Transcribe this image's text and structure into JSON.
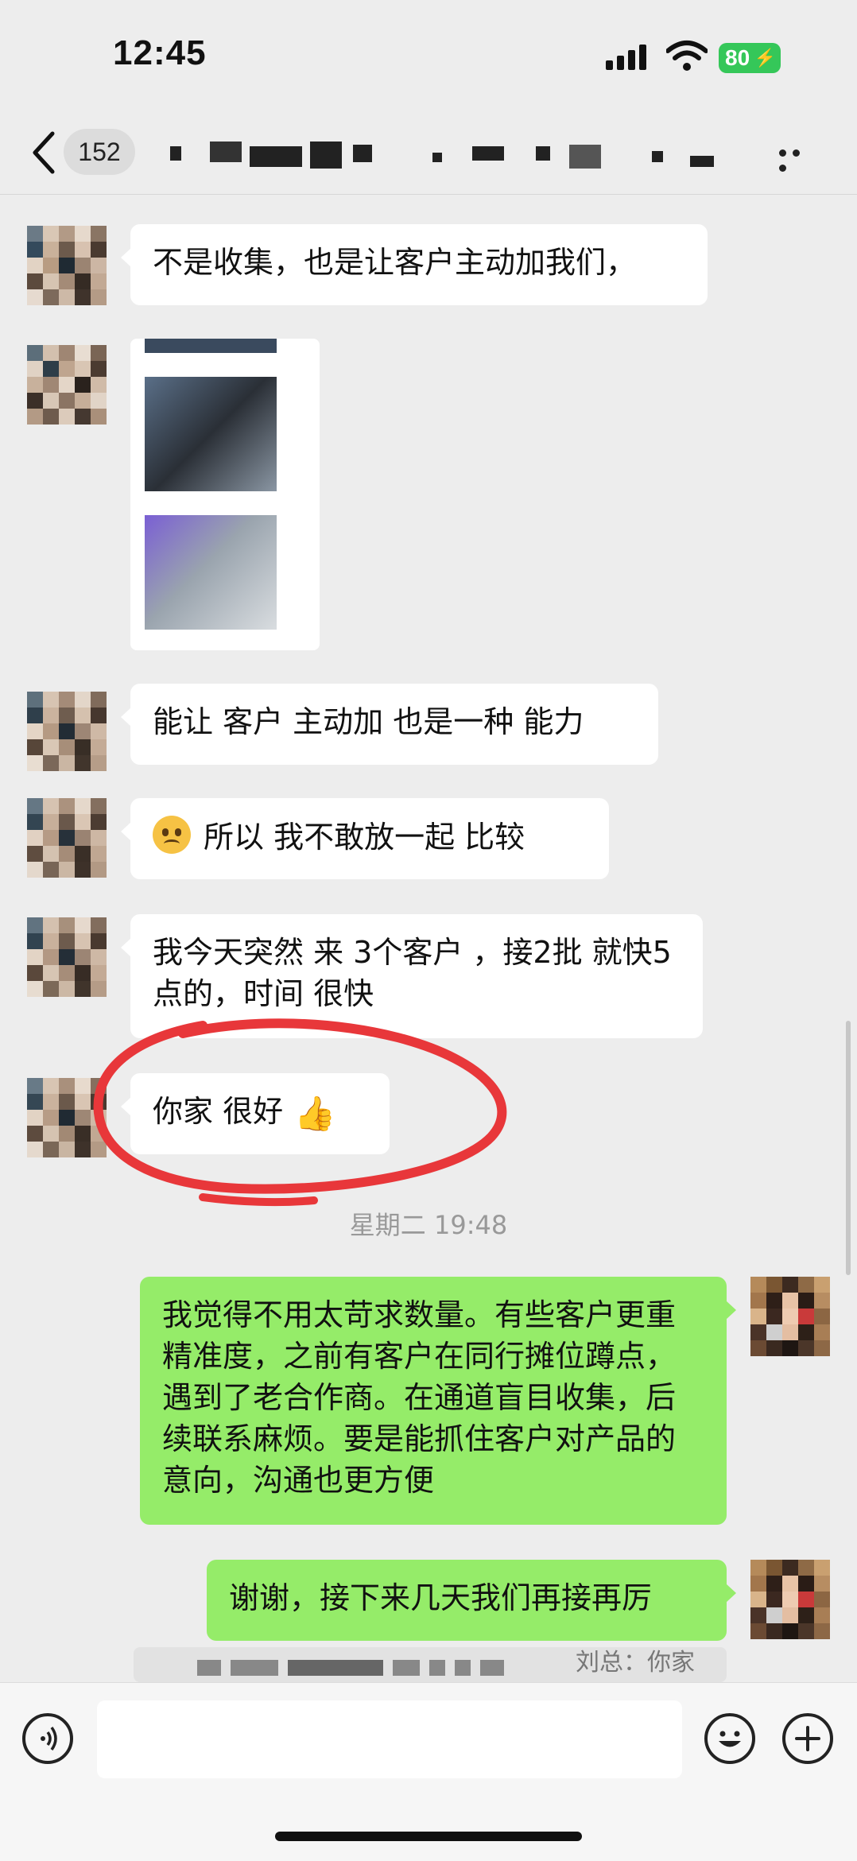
{
  "status_bar": {
    "time": "12:45",
    "battery": "80"
  },
  "header": {
    "unread_count": "152",
    "back_icon": "chevron-left-icon",
    "more_icon": "ellipsis-icon"
  },
  "messages": [
    {
      "side": "left",
      "text": "不是收集，也是让客户主动加我们，"
    },
    {
      "side": "left",
      "type": "image"
    },
    {
      "side": "left",
      "text": "能让 客户 主动加 也是一种 能力"
    },
    {
      "side": "left",
      "emoji": "crying-face",
      "text": "所以 我不敢放一起 比较"
    },
    {
      "side": "left",
      "text": "我今天突然 来 3个客户 ，接2批 就快5点的，时间 很快"
    },
    {
      "side": "left",
      "text": "你家 很好",
      "emoji": "👍"
    },
    {
      "side": "right",
      "text": "我觉得不用太苛求数量。有些客户更重精准度，之前有客户在同行摊位蹲点，遇到了老合作商。在通道盲目收集，后续联系麻烦。要是能抓住客户对产品的意向，沟通也更方便"
    },
    {
      "side": "right",
      "text": "谢谢，接下来几天我们再接再厉"
    }
  ],
  "timestamp": "星期二 19:48",
  "quote_preview": "刘总：你家",
  "input": {
    "placeholder": ""
  },
  "colors": {
    "background": "#ededed",
    "sent_bubble": "#95ec69",
    "received_bubble": "#ffffff",
    "annotation": "#e8373a"
  }
}
